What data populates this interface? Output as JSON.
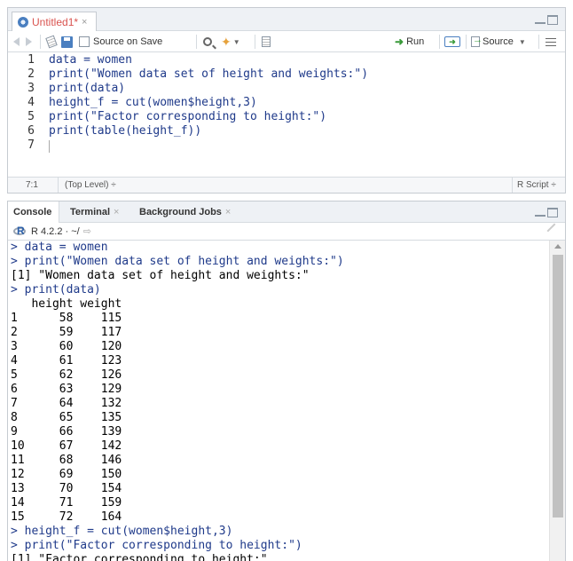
{
  "editor": {
    "tab_title": "Untitled1*",
    "tab_close": "×",
    "toolbar": {
      "source_on_save": "Source on Save",
      "run": "Run",
      "source": "Source"
    },
    "line_numbers": [
      "1",
      "2",
      "3",
      "4",
      "5",
      "6",
      "7"
    ],
    "code_lines": [
      "data = women",
      "print(\"Women data set of height and weights:\")",
      "print(data)",
      "height_f = cut(women$height,3)",
      "print(\"Factor corresponding to height:\")",
      "print(table(height_f))",
      ""
    ],
    "status": {
      "position": "7:1",
      "scope": "(Top Level) ÷",
      "filetype": "R Script ÷"
    }
  },
  "console": {
    "tabs": [
      {
        "label": "Console",
        "close": ""
      },
      {
        "label": "Terminal",
        "close": "×"
      },
      {
        "label": "Background Jobs",
        "close": "×"
      }
    ],
    "r_version": "R 4.2.2 · ~/",
    "lines": [
      {
        "text": "> data = women",
        "kind": "prompt"
      },
      {
        "text": "> print(\"Women data set of height and weights:\")",
        "kind": "prompt"
      },
      {
        "text": "[1] \"Women data set of height and weights:\"",
        "kind": "output"
      },
      {
        "text": "> print(data)",
        "kind": "prompt"
      },
      {
        "text": "   height weight",
        "kind": "output"
      },
      {
        "text": "1      58    115",
        "kind": "output"
      },
      {
        "text": "2      59    117",
        "kind": "output"
      },
      {
        "text": "3      60    120",
        "kind": "output"
      },
      {
        "text": "4      61    123",
        "kind": "output"
      },
      {
        "text": "5      62    126",
        "kind": "output"
      },
      {
        "text": "6      63    129",
        "kind": "output"
      },
      {
        "text": "7      64    132",
        "kind": "output"
      },
      {
        "text": "8      65    135",
        "kind": "output"
      },
      {
        "text": "9      66    139",
        "kind": "output"
      },
      {
        "text": "10     67    142",
        "kind": "output"
      },
      {
        "text": "11     68    146",
        "kind": "output"
      },
      {
        "text": "12     69    150",
        "kind": "output"
      },
      {
        "text": "13     70    154",
        "kind": "output"
      },
      {
        "text": "14     71    159",
        "kind": "output"
      },
      {
        "text": "15     72    164",
        "kind": "output"
      },
      {
        "text": "> height_f = cut(women$height,3)",
        "kind": "prompt"
      },
      {
        "text": "> print(\"Factor corresponding to height:\")",
        "kind": "prompt"
      },
      {
        "text": "[1] \"Factor corresponding to height:\"",
        "kind": "output"
      }
    ]
  }
}
